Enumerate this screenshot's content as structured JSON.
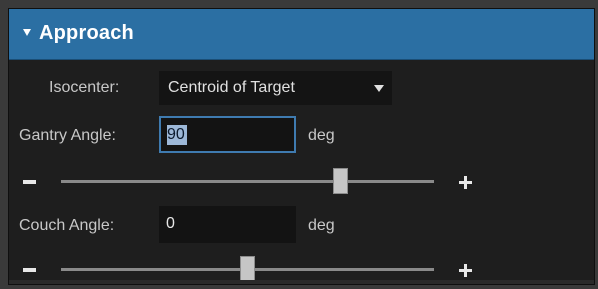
{
  "section": {
    "title": "Approach"
  },
  "isocenter": {
    "label": "Isocenter:",
    "selected": "Centroid of Target"
  },
  "gantry": {
    "label": "Gantry Angle:",
    "value": "90",
    "unit": "deg",
    "slider_value": 90,
    "slider_range": [
      -180,
      180
    ]
  },
  "couch": {
    "label": "Couch Angle:",
    "value": "0",
    "unit": "deg",
    "slider_value": 0,
    "slider_range": [
      -180,
      180
    ]
  },
  "colors": {
    "header": "#2b6fa3",
    "panel": "#1e1e1e",
    "field_focus_border": "#3f7bb0",
    "text": "#c8c8c8"
  },
  "icons": {
    "collapse": "triangle-down-icon",
    "dropdown": "caret-down-icon",
    "decrement": "minus-icon",
    "increment": "plus-icon"
  }
}
